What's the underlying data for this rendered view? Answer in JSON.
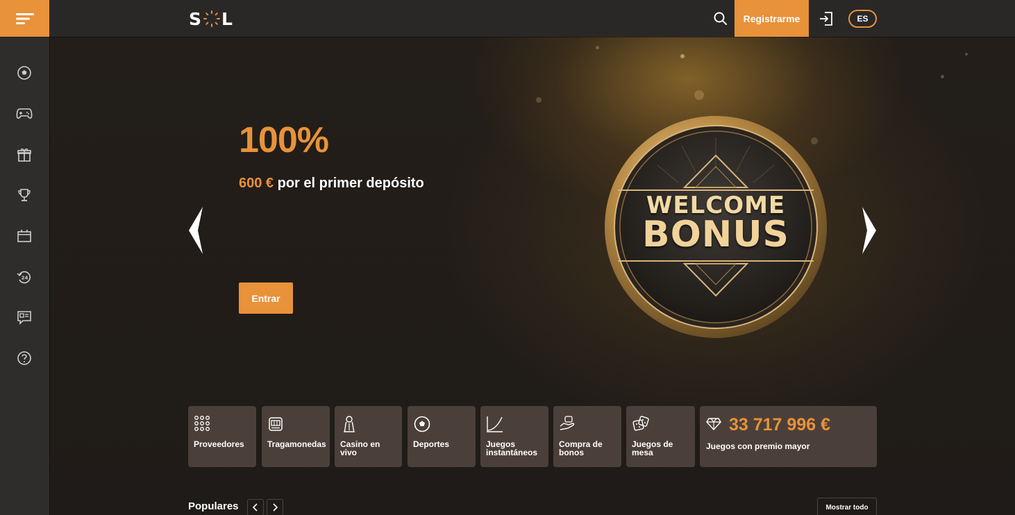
{
  "header": {
    "logo_text_left": "S",
    "logo_text_right": "L",
    "register_label": "Registrarme",
    "language": "ES",
    "icons": [
      "menu-icon",
      "search-icon",
      "login-icon"
    ]
  },
  "sidebar": {
    "items": [
      {
        "icon": "soccer-ball-icon"
      },
      {
        "icon": "gamepad-icon"
      },
      {
        "icon": "gift-icon"
      },
      {
        "icon": "trophy-icon"
      },
      {
        "icon": "calendar-icon"
      },
      {
        "icon": "support-24-icon"
      },
      {
        "icon": "chat-icon"
      },
      {
        "icon": "help-icon"
      }
    ]
  },
  "hero": {
    "title": "100%",
    "subtitle_amount": "600 €",
    "subtitle_text": " por el primer depósito",
    "cta_label": "Entrar",
    "coin_line1": "WELCOME",
    "coin_line2": "BONUS"
  },
  "categories": [
    {
      "label": "Proveedores",
      "icon": "grid-dots-icon"
    },
    {
      "label": "Tragamonedas",
      "icon": "slot-machine-icon"
    },
    {
      "label": "Casino en vivo",
      "icon": "live-dealer-icon"
    },
    {
      "label": "Deportes",
      "icon": "soccer-ball-icon"
    },
    {
      "label": "Juegos instantáneos",
      "icon": "chart-curve-icon"
    },
    {
      "label": "Compra de bonos",
      "icon": "hand-coin-icon"
    },
    {
      "label": "Juegos de mesa",
      "icon": "dice-icon"
    }
  ],
  "jackpot": {
    "amount": "33 717 996 €",
    "label": "Juegos con premio mayor",
    "icon": "diamond-icon"
  },
  "popular": {
    "title": "Populares",
    "show_all_label": "Mostrar todo"
  },
  "colors": {
    "accent": "#e8923a",
    "topbar": "#2a2827",
    "sidebar": "#2f2d2c",
    "tile": "#4b4039"
  }
}
